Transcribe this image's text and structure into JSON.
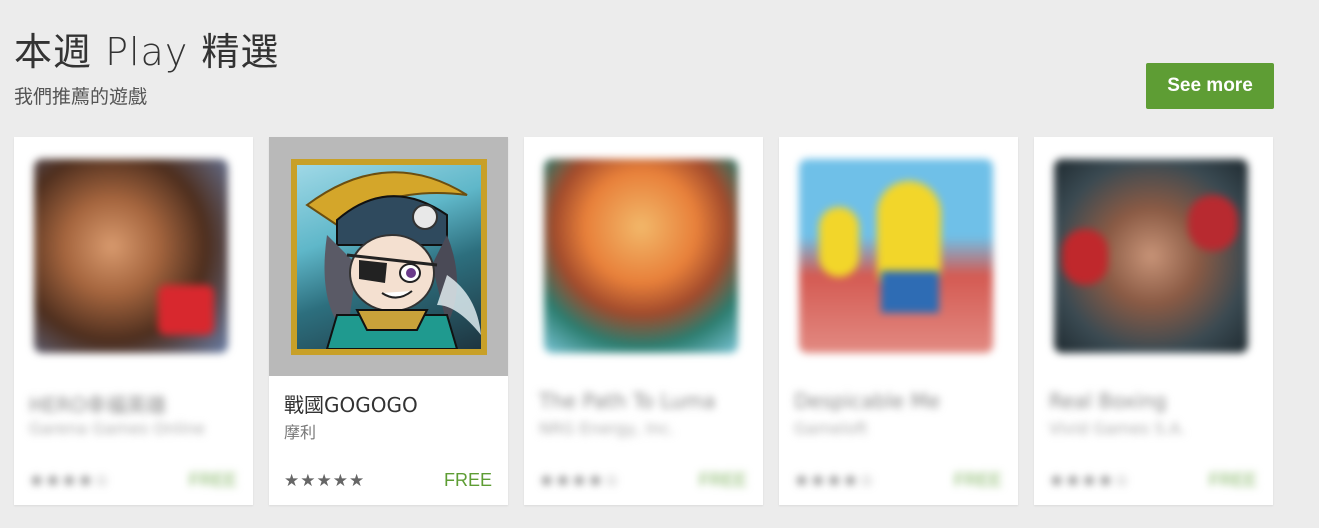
{
  "header": {
    "title": "本週 Play 精選",
    "subtitle": "我們推薦的遊戲"
  },
  "actions": {
    "see_more_label": "See more"
  },
  "colors": {
    "accent": "#5e9d34",
    "background": "#ececec"
  },
  "apps": [
    {
      "name": "HERO幸福英雄",
      "developer": "Garena Games Online",
      "stars": "★★★★☆",
      "price": "FREE",
      "icon": "hero-warrior-icon",
      "state": "blurred"
    },
    {
      "name": "戰國GOGOGO",
      "developer": "摩利",
      "stars": "★★★★★",
      "rating": 4.5,
      "price": "FREE",
      "icon": "samurai-chibi-icon",
      "state": "focused"
    },
    {
      "name": "The Path To Luma",
      "developer": "NRG Energy, Inc.",
      "stars": "★★★★☆",
      "price": "FREE",
      "icon": "sunset-mountain-icon",
      "state": "blurred"
    },
    {
      "name": "Despicable Me",
      "developer": "Gameloft",
      "stars": "★★★★☆",
      "price": "FREE",
      "icon": "minion-icon",
      "state": "blurred"
    },
    {
      "name": "Real Boxing",
      "developer": "Vivid Games S.A.",
      "stars": "★★★★☆",
      "price": "FREE",
      "icon": "boxer-icon",
      "state": "blurred"
    }
  ]
}
